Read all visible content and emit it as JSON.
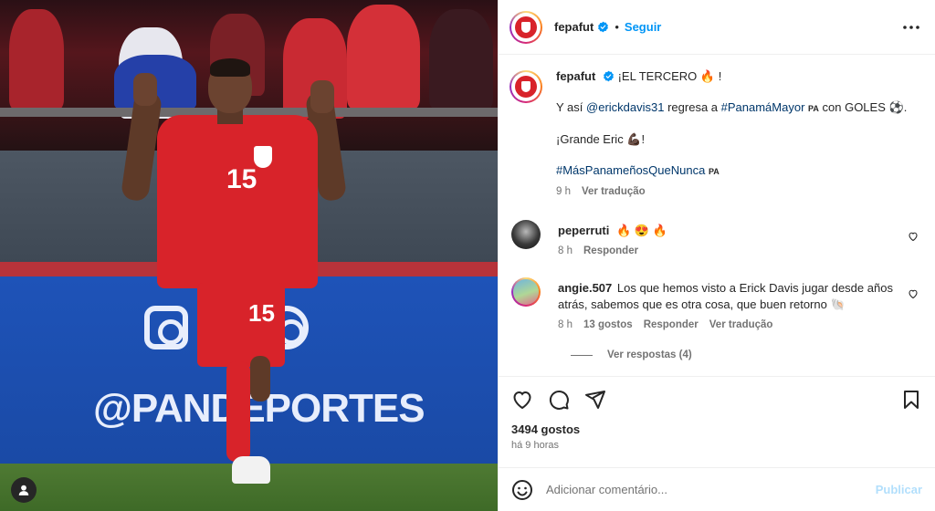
{
  "post": {
    "account": "fepafut",
    "follow_label": "Seguir",
    "dot": "•",
    "caption": {
      "line1_text": "¡EL TERCERO",
      "line1_emoji": "🔥",
      "line1_end": "!",
      "line2_pre": "Y así",
      "line2_mention": "@erickdavis31",
      "line2_mid": "regresa a",
      "line2_hashtag": "#PanamáMayor",
      "flag_label": "PA",
      "line2_post": "con GOLES",
      "line2_emoji": "⚽",
      "line2_end": ".",
      "line3_text": "¡Grande Eric",
      "line3_emoji": "💪🏿",
      "line3_end": "!",
      "line4_hashtag": "#MásPanameñosQueNunca",
      "line4_flag": "PA"
    },
    "caption_time": "9 h",
    "see_translation": "Ver tradução",
    "likes": "3494 gostos",
    "posted_ago": "há 9 horas",
    "photo": {
      "board_brand": "@PANDEPORTES",
      "jersey_number": "15"
    }
  },
  "comments": [
    {
      "user": "peperruti",
      "text": "🔥 😍 🔥",
      "time": "8 h",
      "reply_label": "Responder"
    },
    {
      "user": "angie.507",
      "text": "Los que hemos visto a Erick Davis jugar desde años atrás, sabemos que es otra cosa, que buen retorno 🐚",
      "time": "8 h",
      "likes": "13 gostos",
      "reply_label": "Responder",
      "translate_label": "Ver tradução",
      "view_replies": "Ver respostas (4)"
    }
  ],
  "composer": {
    "placeholder": "Adicionar comentário...",
    "publish_label": "Publicar"
  },
  "colors": {
    "link_blue": "#0095f6",
    "hashtag": "#00376b",
    "muted": "#737373",
    "jersey_red": "#d8232a"
  },
  "icons": [
    "verified-icon",
    "more-options-icon",
    "heart-icon",
    "comment-icon",
    "share-icon",
    "save-icon",
    "emoji-icon",
    "user-tag-icon"
  ]
}
